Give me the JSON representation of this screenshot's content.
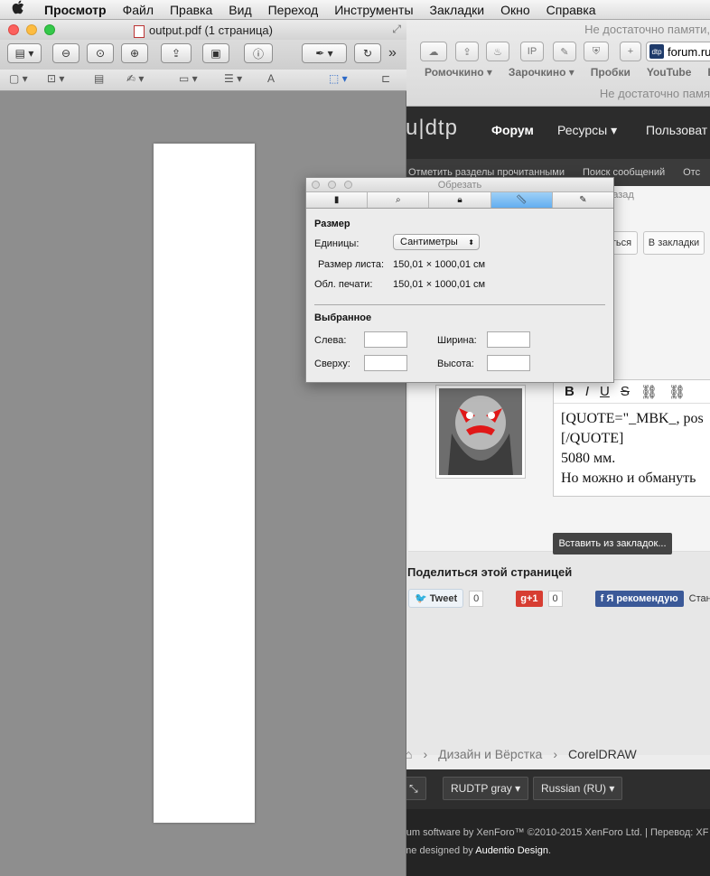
{
  "menubar": {
    "apple": "",
    "items": [
      "Просмотр",
      "Файл",
      "Правка",
      "Вид",
      "Переход",
      "Инструменты",
      "Закладки",
      "Окно",
      "Справка"
    ]
  },
  "browser": {
    "memory_warning": "Не достаточно памяти,",
    "memory_warning2": "Не достаточно памя",
    "url_text": "forum.ru",
    "url_favicon": "dtp",
    "toolbar_ip": "IP",
    "bookmarks": [
      "Ромочкино ▾",
      "Зарочкино ▾",
      "Пробки",
      "YouTube",
      "Ви"
    ],
    "site_logo": "ru|dtp",
    "nav": {
      "forum": "Форум",
      "resources": "Ресурсы ▾",
      "users": "Пользоват"
    },
    "subnav": [
      "Отметить разделы прочитанными",
      "Поиск сообщений",
      "Отс"
    ],
    "ago": "н. назад",
    "btn_share_partial": "ться",
    "btn_bookmarks": "В закладки",
    "editor": {
      "tools": [
        "B",
        "I",
        "U",
        "S",
        "⛓",
        "⛓"
      ],
      "lines": [
        "[QUOTE=\"_MBK_, pos",
        "[/QUOTE]",
        "5080 мм.",
        "Но можно и обмануть"
      ]
    },
    "insert_btn": "Вставить из закладок...",
    "share_title": "Поделиться этой страницей",
    "tweet": "Tweet",
    "tweet_count": "0",
    "gplus": "g+1",
    "gplus_count": "0",
    "fb": "Я рекомендую",
    "fb_tail": "Стан",
    "breadcrumb": [
      "Дизайн и Вёрстка",
      "CorelDRAW"
    ],
    "footer_buttons": [
      "RUDTP gray ▾",
      "Russian (RU) ▾"
    ],
    "footer_line1": "orum software by XenForo™ ©2010-2015 XenForo Ltd. | Перевод: XF",
    "footer_line2a": "eme designed by ",
    "footer_line2b": "Audentio Design",
    "footer_line2c": "."
  },
  "preview": {
    "title": "output.pdf (1 страница)",
    "toolbar_more": "»"
  },
  "crop": {
    "title": "Обрезать",
    "size_section": "Размер",
    "units_label": "Единицы:",
    "units_value": "Сантиметры",
    "page_size_label": "Размер листа:",
    "page_size_value": "150,01 × 1000,01 см",
    "print_area_label": "Обл. печати:",
    "print_area_value": "150,01 × 1000,01 см",
    "selection_section": "Выбранное",
    "left_label": "Слева:",
    "top_label": "Сверху:",
    "width_label": "Ширина:",
    "height_label": "Высота:",
    "left_value": "",
    "top_value": "",
    "width_value": "",
    "height_value": ""
  }
}
